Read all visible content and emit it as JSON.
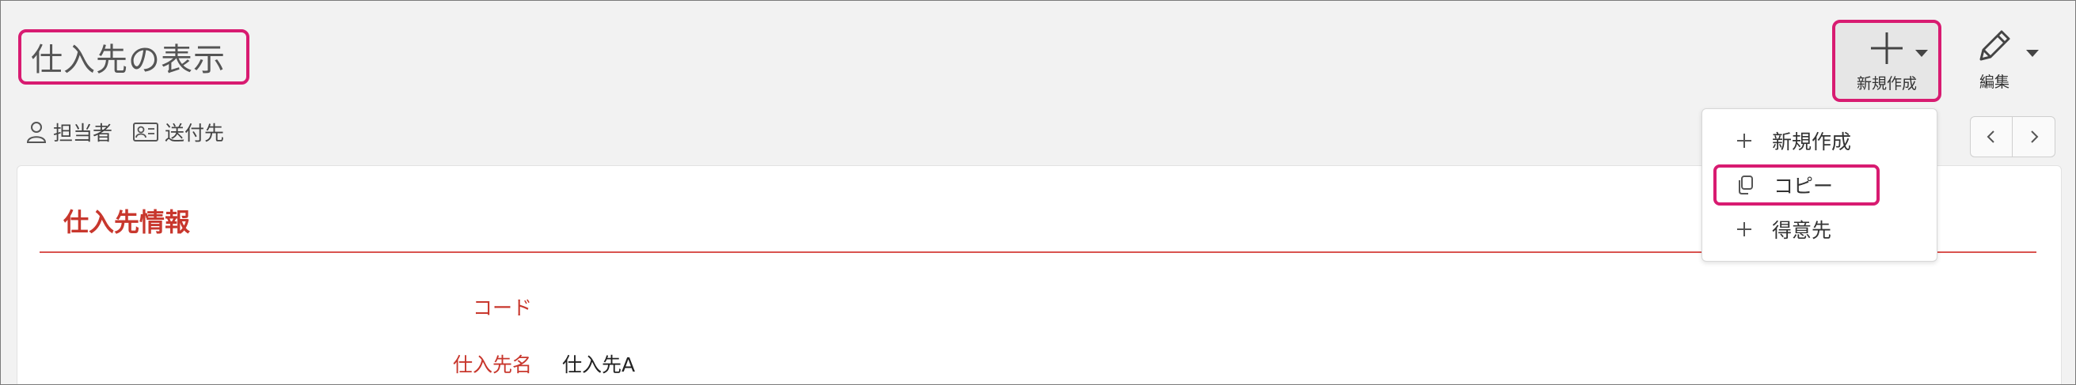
{
  "page": {
    "title": "仕入先の表示"
  },
  "subnav": {
    "items": [
      {
        "label": "担当者",
        "icon": "person-icon"
      },
      {
        "label": "送付先",
        "icon": "contact-card-icon"
      }
    ]
  },
  "toolbar": {
    "new_label": "新規作成",
    "edit_label": "編集"
  },
  "new_menu": {
    "items": [
      {
        "label": "新規作成",
        "icon": "plus-icon"
      },
      {
        "label": "コピー",
        "icon": "copy-icon"
      },
      {
        "label": "得意先",
        "icon": "plus-icon"
      }
    ]
  },
  "section": {
    "title": "仕入先情報",
    "fields": [
      {
        "label": "コード",
        "value": ""
      },
      {
        "label": "仕入先名",
        "value": "仕入先A"
      }
    ]
  },
  "colors": {
    "accent": "#d81b71",
    "section_red": "#c8372d"
  }
}
